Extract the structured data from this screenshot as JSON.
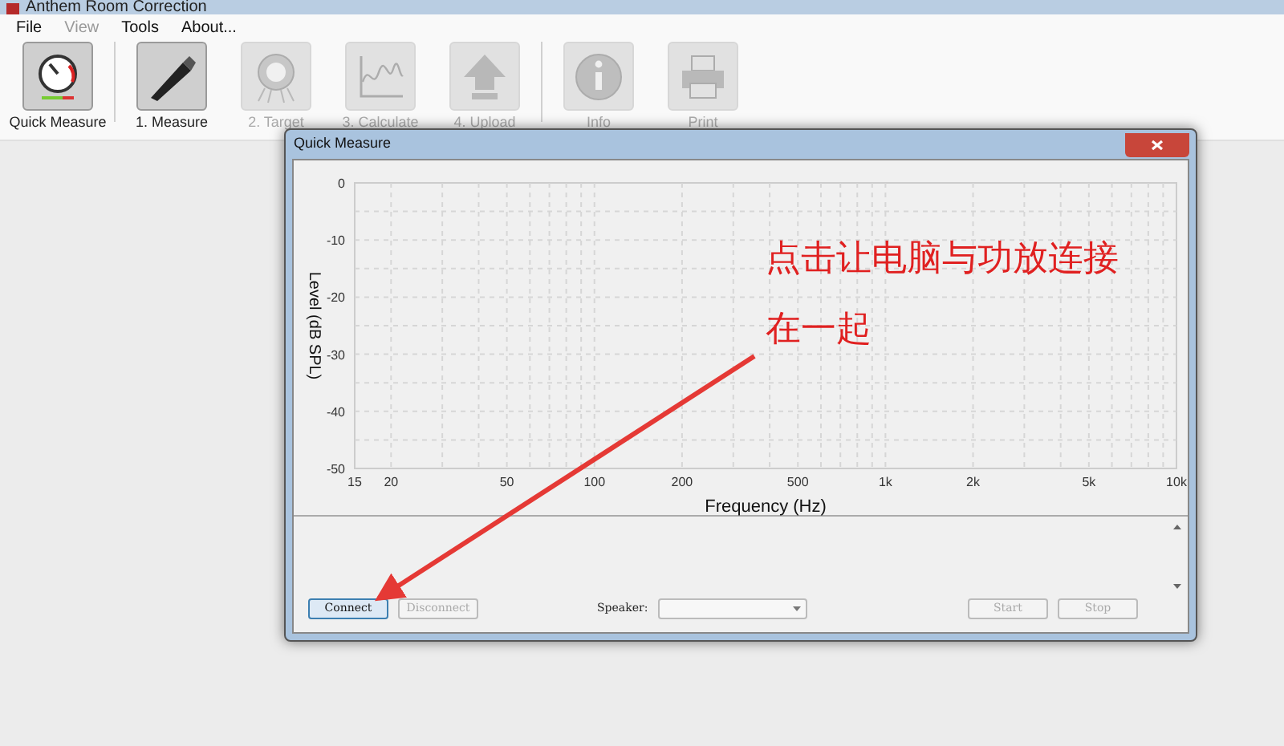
{
  "window": {
    "title": "Anthem Room Correction"
  },
  "menu": [
    {
      "label": "File",
      "disabled": false
    },
    {
      "label": "View",
      "disabled": true
    },
    {
      "label": "Tools",
      "disabled": false
    },
    {
      "label": "About...",
      "disabled": false
    }
  ],
  "toolbar": [
    {
      "kind": "gauge",
      "label": "Quick Measure",
      "disabled": false,
      "separator_after": true
    },
    {
      "kind": "microphone",
      "label": "1. Measure",
      "disabled": false,
      "separator_after": false
    },
    {
      "kind": "target",
      "label": "2. Target",
      "disabled": true,
      "separator_after": false
    },
    {
      "kind": "graph",
      "label": "3. Calculate",
      "disabled": true,
      "separator_after": false
    },
    {
      "kind": "upload",
      "label": "4. Upload",
      "disabled": true,
      "separator_after": true
    },
    {
      "kind": "info",
      "label": "Info",
      "disabled": true,
      "separator_after": false
    },
    {
      "kind": "print",
      "label": "Print",
      "disabled": true,
      "separator_after": false
    }
  ],
  "dialog": {
    "title": "Quick Measure",
    "graph": {
      "x_axis_title": "Frequency (Hz)",
      "y_axis_title": "Level (dB SPL)",
      "x_axis_labels": [
        "15",
        "20",
        "50",
        "100",
        "200",
        "500",
        "1k",
        "2k",
        "5k",
        "10k"
      ],
      "y_axis_labels": [
        "0",
        "-10",
        "-20",
        "-30",
        "-40",
        "-50"
      ]
    },
    "buttons": [
      {
        "label": "Connect",
        "disabled": false
      },
      {
        "label": "Disconnect",
        "disabled": true
      }
    ],
    "speaker_label": "Speaker:",
    "actions": [
      {
        "label": "Start",
        "disabled": true
      },
      {
        "label": "Stop",
        "disabled": true
      }
    ]
  },
  "annotation": {
    "lines": [
      "点击让电脑与功放连接",
      "在一起"
    ]
  }
}
